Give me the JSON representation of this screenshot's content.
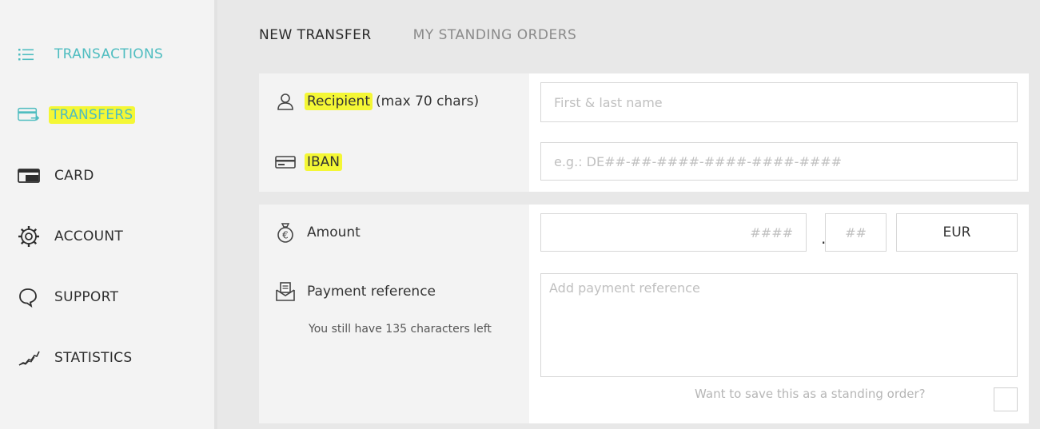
{
  "sidebar": {
    "items": [
      {
        "label": "TRANSACTIONS",
        "icon": "list-icon"
      },
      {
        "label": "TRANSFERS",
        "icon": "transfer-card-icon"
      },
      {
        "label": "CARD",
        "icon": "card-icon"
      },
      {
        "label": "ACCOUNT",
        "icon": "gear-icon"
      },
      {
        "label": "SUPPORT",
        "icon": "chat-bubble-icon"
      },
      {
        "label": "STATISTICS",
        "icon": "trend-chart-icon"
      }
    ],
    "accent_color": "#4fbdc0",
    "highlight_color": "#f4f735"
  },
  "tabs": [
    {
      "label": "NEW TRANSFER",
      "active": true
    },
    {
      "label": "MY STANDING ORDERS",
      "active": false
    }
  ],
  "recipient": {
    "label": "Recipient",
    "sublabel": "(max 70 chars)",
    "placeholder": "First & last name"
  },
  "iban": {
    "label": "IBAN",
    "placeholder": "e.g.: DE##-##-####-####-####-####"
  },
  "amount": {
    "label": "Amount",
    "whole_placeholder": "####",
    "separator": ".",
    "cents_placeholder": "##",
    "currency": "EUR"
  },
  "reference": {
    "label": "Payment reference",
    "placeholder": "Add payment reference",
    "remaining_text": "You still have 135 characters left"
  },
  "standing_order": {
    "label": "Want to save this as a standing order?"
  }
}
